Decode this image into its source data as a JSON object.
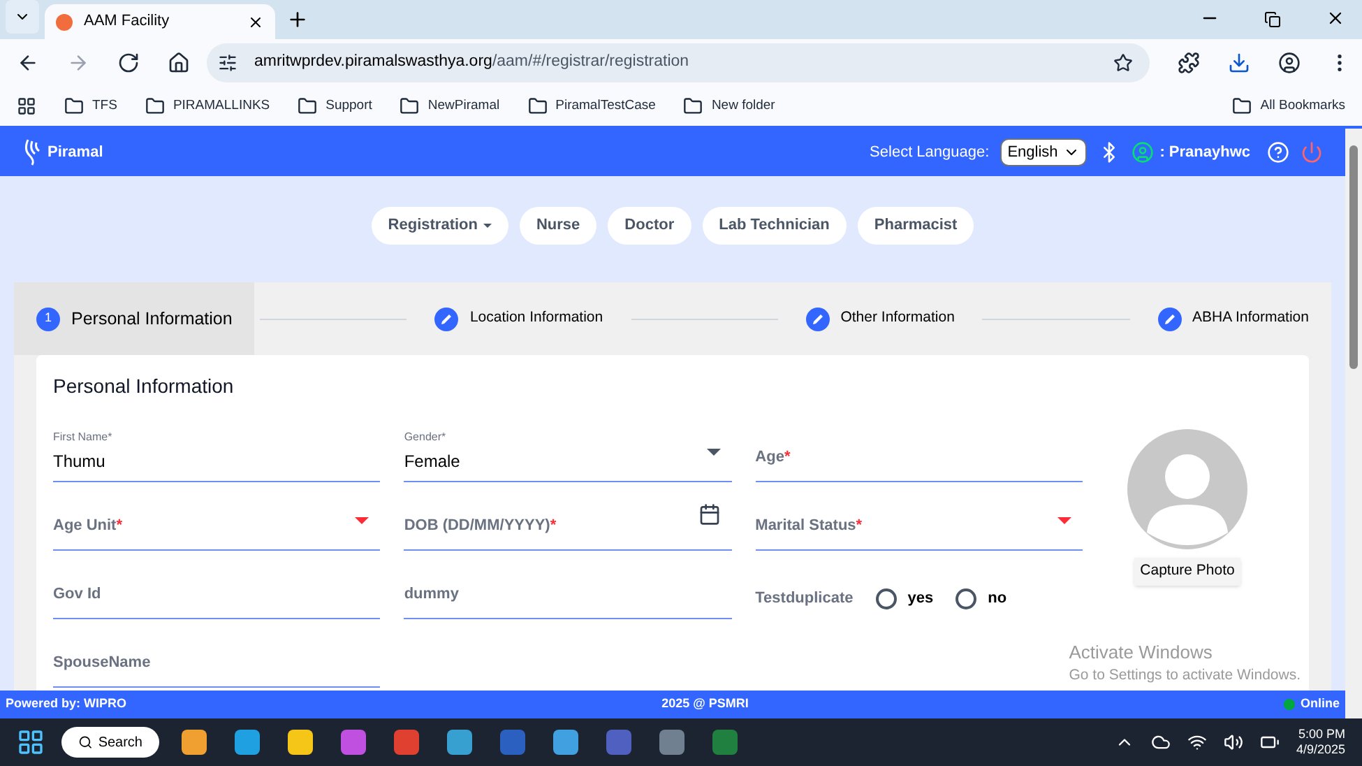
{
  "browser": {
    "tab_title": "AAM Facility",
    "url_host": "amritwprdev.piramalswasthya.org",
    "url_path": "/aam/#/registrar/registration",
    "bookmarks": [
      "TFS",
      "PIRAMALLINKS",
      "Support",
      "NewPiramal",
      "PiramalTestCase",
      "New folder"
    ],
    "all_bookmarks": "All Bookmarks"
  },
  "header": {
    "logo": "Piramal",
    "language_label": "Select Language:",
    "language": "English",
    "user": ": Pranayhwc"
  },
  "nav": [
    {
      "label": "Registration",
      "dropdown": true
    },
    {
      "label": "Nurse",
      "dropdown": false
    },
    {
      "label": "Doctor",
      "dropdown": false
    },
    {
      "label": "Lab Technician",
      "dropdown": false
    },
    {
      "label": "Pharmacist",
      "dropdown": false
    }
  ],
  "steps": [
    {
      "label": "Personal Information",
      "number": "1",
      "selected": true
    },
    {
      "label": "Location Information",
      "selected": false
    },
    {
      "label": "Other Information",
      "selected": false
    },
    {
      "label": "ABHA Information",
      "selected": false
    }
  ],
  "form": {
    "title": "Personal Information",
    "fields": [
      {
        "kind": "text",
        "label": "First Name",
        "asterisk": "*",
        "value": "Thumu"
      },
      {
        "kind": "select",
        "label": "Gender",
        "asterisk": "*",
        "value": "Female"
      },
      {
        "kind": "text",
        "label": "Age",
        "asterisk": "*"
      },
      {
        "kind": "select",
        "label": "Age Unit",
        "asterisk": "*"
      },
      {
        "kind": "date",
        "label": "DOB (DD/MM/YYYY)",
        "asterisk": "*"
      },
      {
        "kind": "select",
        "label": "Marital Status",
        "asterisk": "*"
      },
      {
        "kind": "text",
        "label": "Gov Id"
      },
      {
        "kind": "text",
        "label": "dummy"
      },
      {
        "kind": "radio",
        "label": "Testduplicate",
        "options": [
          {
            "label": "yes",
            "selected": false
          },
          {
            "label": "no",
            "selected": false
          }
        ]
      },
      {
        "kind": "text",
        "label": "SpouseName"
      }
    ],
    "capture_button": "Capture Photo"
  },
  "watermark_os": {
    "title": "Activate Windows",
    "subtitle": "Go to Settings to activate Windows."
  },
  "footer": {
    "left": "Powered by: WIPRO",
    "center": "2025 @ PSMRI",
    "status": "Online"
  },
  "taskbar": {
    "search": "Search",
    "time": "5:00 PM",
    "date": "4/9/2025"
  }
}
